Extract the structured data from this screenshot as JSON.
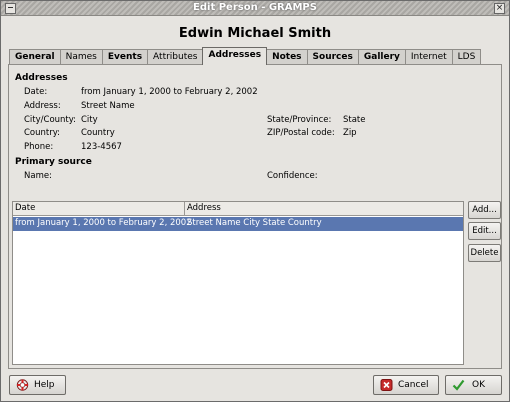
{
  "window": {
    "title": "Edit Person - GRAMPS"
  },
  "person_name": "Edwin Michael Smith",
  "tabs": [
    {
      "label": "General",
      "bold": true
    },
    {
      "label": "Names",
      "bold": false
    },
    {
      "label": "Events",
      "bold": true
    },
    {
      "label": "Attributes",
      "bold": false
    },
    {
      "label": "Addresses",
      "bold": true,
      "active": true
    },
    {
      "label": "Notes",
      "bold": true
    },
    {
      "label": "Sources",
      "bold": true
    },
    {
      "label": "Gallery",
      "bold": true
    },
    {
      "label": "Internet",
      "bold": false
    },
    {
      "label": "LDS",
      "bold": false
    }
  ],
  "details": {
    "section_title": "Addresses",
    "date_label": "Date:",
    "date_value": "from January 1, 2000 to February 2, 2002",
    "address_label": "Address:",
    "address_value": "Street Name",
    "city_label": "City/County:",
    "city_value": "City",
    "state_label": "State/Province:",
    "state_value": "State",
    "country_label": "Country:",
    "country_value": "Country",
    "zip_label": "ZIP/Postal code:",
    "zip_value": "Zip",
    "phone_label": "Phone:",
    "phone_value": "123-4567",
    "source_title": "Primary source",
    "name_label": "Name:",
    "confidence_label": "Confidence:"
  },
  "list": {
    "columns": [
      "Date",
      "Address"
    ],
    "rows": [
      {
        "date": "from January 1, 2000 to February 2, 2002",
        "address": "Street Name City State Country",
        "selected": true
      }
    ]
  },
  "side_buttons": {
    "add": "Add...",
    "edit": "Edit...",
    "delete": "Delete"
  },
  "bottom_buttons": {
    "help": "Help",
    "cancel": "Cancel",
    "ok": "OK"
  },
  "colors": {
    "selection": "#5a77b0",
    "window_bg": "#e6e4e0"
  }
}
